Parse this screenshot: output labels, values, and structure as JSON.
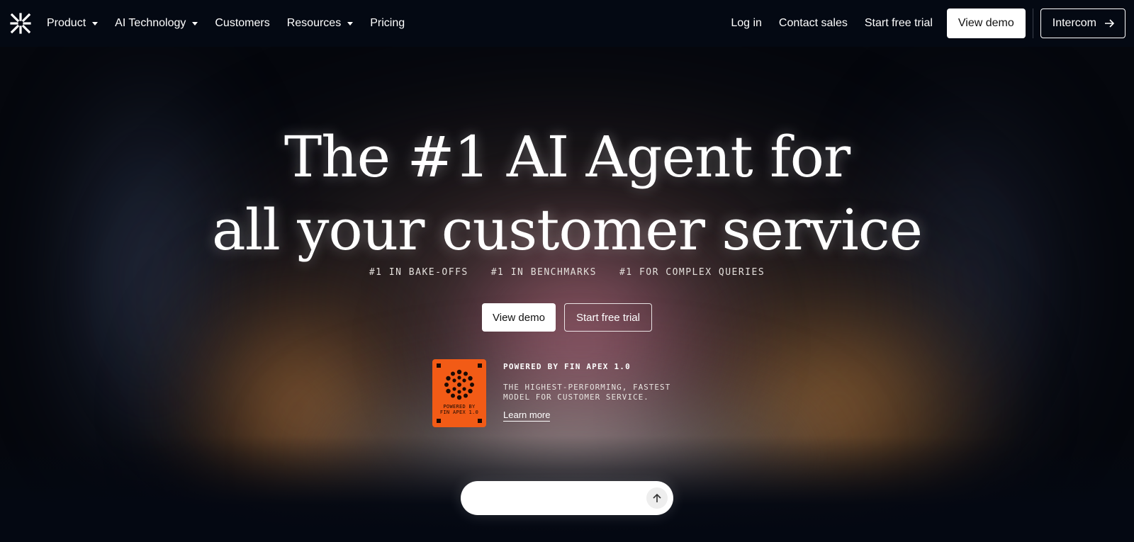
{
  "nav": {
    "logo_icon": "intercom-logo-icon",
    "items": [
      {
        "label": "Product",
        "has_dropdown": true
      },
      {
        "label": "AI Technology",
        "has_dropdown": true
      },
      {
        "label": "Customers",
        "has_dropdown": false
      },
      {
        "label": "Resources",
        "has_dropdown": true
      },
      {
        "label": "Pricing",
        "has_dropdown": false
      }
    ],
    "login": "Log in",
    "contact_sales": "Contact sales",
    "start_trial": "Start free trial",
    "view_demo": "View demo",
    "intercom": "Intercom"
  },
  "hero": {
    "headline_line1": "The #1 AI Agent for",
    "headline_line2": "all your customer service",
    "badges": [
      "#1 IN BAKE-OFFS",
      "#1 IN BENCHMARKS",
      "#1 FOR COMPLEX QUERIES"
    ],
    "cta_primary": "View demo",
    "cta_secondary": "Start free trial"
  },
  "powered": {
    "card_text_line1": "POWERED BY",
    "card_text_line2": "FIN APEX 1.0",
    "title": "POWERED BY FIN APEX 1.0",
    "desc_line1": "THE HIGHEST-PERFORMING, FASTEST",
    "desc_line2": "MODEL FOR CUSTOMER SERVICE.",
    "learn_more": "Learn more"
  },
  "ask": {
    "value": "",
    "send_icon": "arrow-up-icon"
  },
  "colors": {
    "nav_bg": "#040913",
    "apex_orange": "#f25b16",
    "button_white": "#ffffff"
  }
}
